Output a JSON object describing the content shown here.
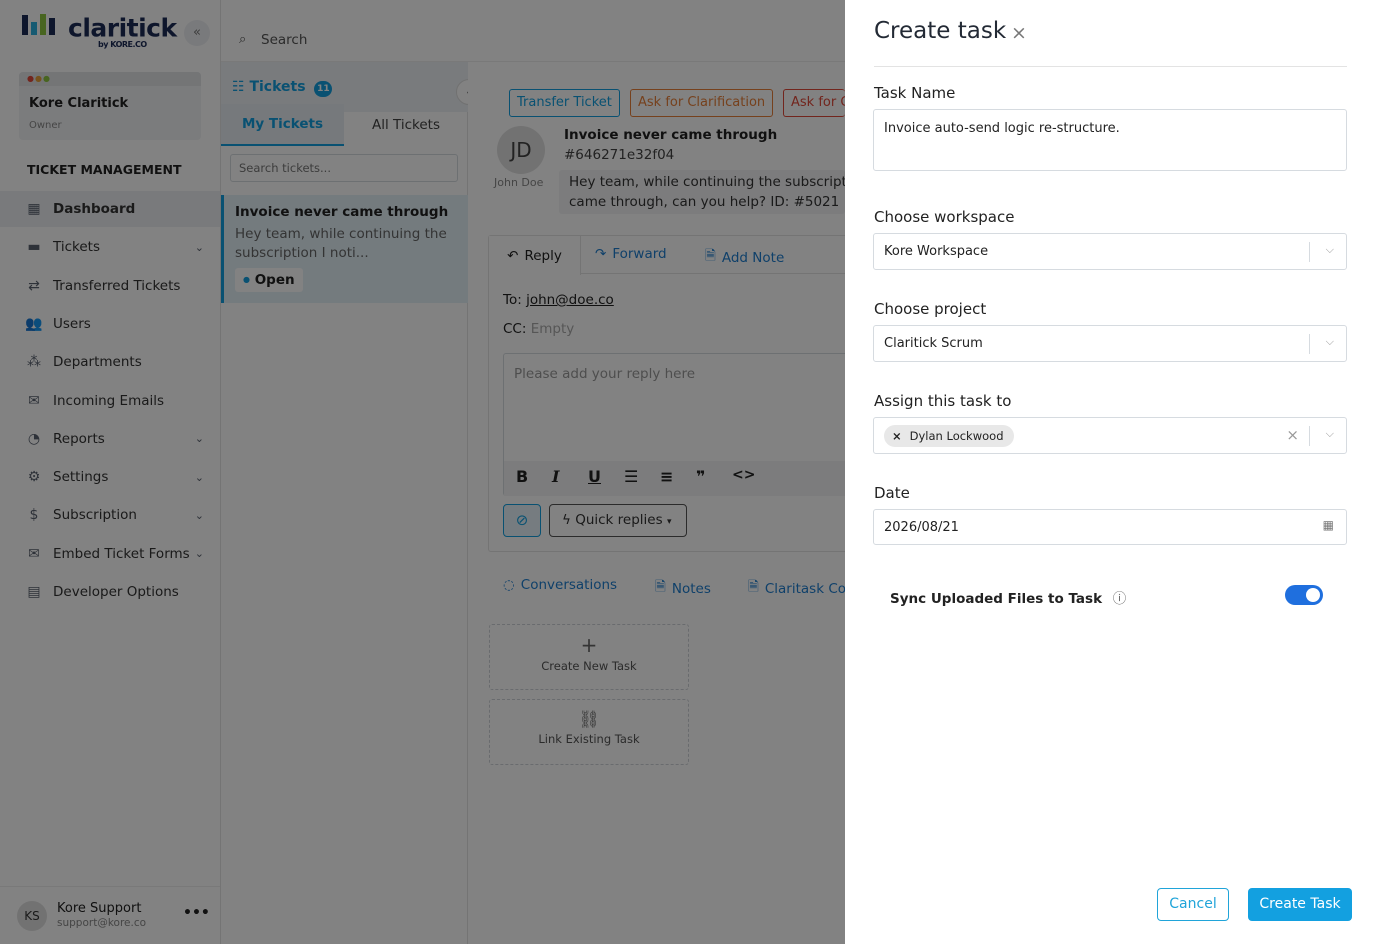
{
  "app": {
    "logo_text": "claritick",
    "logo_sub": "by KORE.CO",
    "collapse_icon": "«"
  },
  "org": {
    "name": "Kore Claritick",
    "role": "Owner"
  },
  "sidebar": {
    "section_title": "TICKET MANAGEMENT",
    "items": [
      {
        "label": "Dashboard",
        "icon": "dashboard-icon",
        "glyph": "▦"
      },
      {
        "label": "Tickets",
        "icon": "ticket-icon",
        "glyph": "▬",
        "chevron": "⌄"
      },
      {
        "label": "Transferred Tickets",
        "icon": "transfer-icon",
        "glyph": "⇄"
      },
      {
        "label": "Users",
        "icon": "users-icon",
        "glyph": "👥"
      },
      {
        "label": "Departments",
        "icon": "departments-icon",
        "glyph": "⁂"
      },
      {
        "label": "Incoming Emails",
        "icon": "email-icon",
        "glyph": "✉"
      },
      {
        "label": "Reports",
        "icon": "reports-icon",
        "glyph": "◔",
        "chevron": "⌄"
      },
      {
        "label": "Settings",
        "icon": "gear-icon",
        "glyph": "⚙",
        "chevron": "⌄"
      },
      {
        "label": "Subscription",
        "icon": "subscription-icon",
        "glyph": "$",
        "chevron": "⌄"
      },
      {
        "label": "Embed Ticket Forms",
        "icon": "embed-icon",
        "glyph": "✉",
        "chevron": "⌄"
      },
      {
        "label": "Developer Options",
        "icon": "developer-icon",
        "glyph": "▤"
      }
    ]
  },
  "user": {
    "initials": "KS",
    "name": "Kore Support",
    "email": "support@kore.co",
    "menu": "•••"
  },
  "topbar": {
    "search_placeholder": "Search"
  },
  "tickets_panel": {
    "title": "Tickets",
    "count": "11",
    "tabs": [
      "My Tickets",
      "All Tickets"
    ],
    "search_placeholder": "Search tickets...",
    "item": {
      "title": "Invoice never came through",
      "preview": "Hey team, while continuing the subscription I noti...",
      "status": "Open"
    },
    "collapse_icon": "‹"
  },
  "ticket": {
    "actions": [
      "Transfer Ticket",
      "Ask for Clarification",
      "Ask for C"
    ],
    "avatar": "JD",
    "author": "John Doe",
    "title": "Invoice never came through",
    "id": "#646271e32f04",
    "body_line1": "Hey team, while continuing the subscripti",
    "body_line2": "came through, can you help? ID: #5021",
    "reply_tabs": [
      "Reply",
      "Forward",
      "Add Note"
    ],
    "to_label": "To:",
    "to_value": "john@doe.co",
    "cc_label": "CC:",
    "cc_value": "Empty",
    "reply_placeholder": "Please add your reply here",
    "format_buttons": [
      "B",
      "I",
      "U",
      "☰",
      "≡",
      "❞",
      "<>"
    ],
    "quick_replies": "Quick replies",
    "bottom_tabs": [
      "Conversations",
      "Notes",
      "Claritask Co"
    ],
    "create_new_task": "Create New Task",
    "link_existing_task": "Link Existing Task"
  },
  "modal": {
    "title": "Create task",
    "close": "×",
    "task_name_label": "Task Name",
    "task_name_value": "Invoice auto-send logic re-structure.",
    "workspace_label": "Choose workspace",
    "workspace_value": "Kore Workspace",
    "project_label": "Choose project",
    "project_value": "Claritick Scrum",
    "assign_label": "Assign this task to",
    "assignee": "Dylan Lockwood",
    "date_label": "Date",
    "date_value": "2026/08/21",
    "sync_label": "Sync Uploaded Files to Task",
    "sync_enabled": true,
    "cancel": "Cancel",
    "create": "Create Task"
  },
  "colors": {
    "accent": "#13a0e0",
    "toggle": "#1f6fde",
    "brand": "#1c2b57",
    "orange": "#e8803a",
    "red": "#e04a3a",
    "blue_link": "#1f7fd0"
  }
}
